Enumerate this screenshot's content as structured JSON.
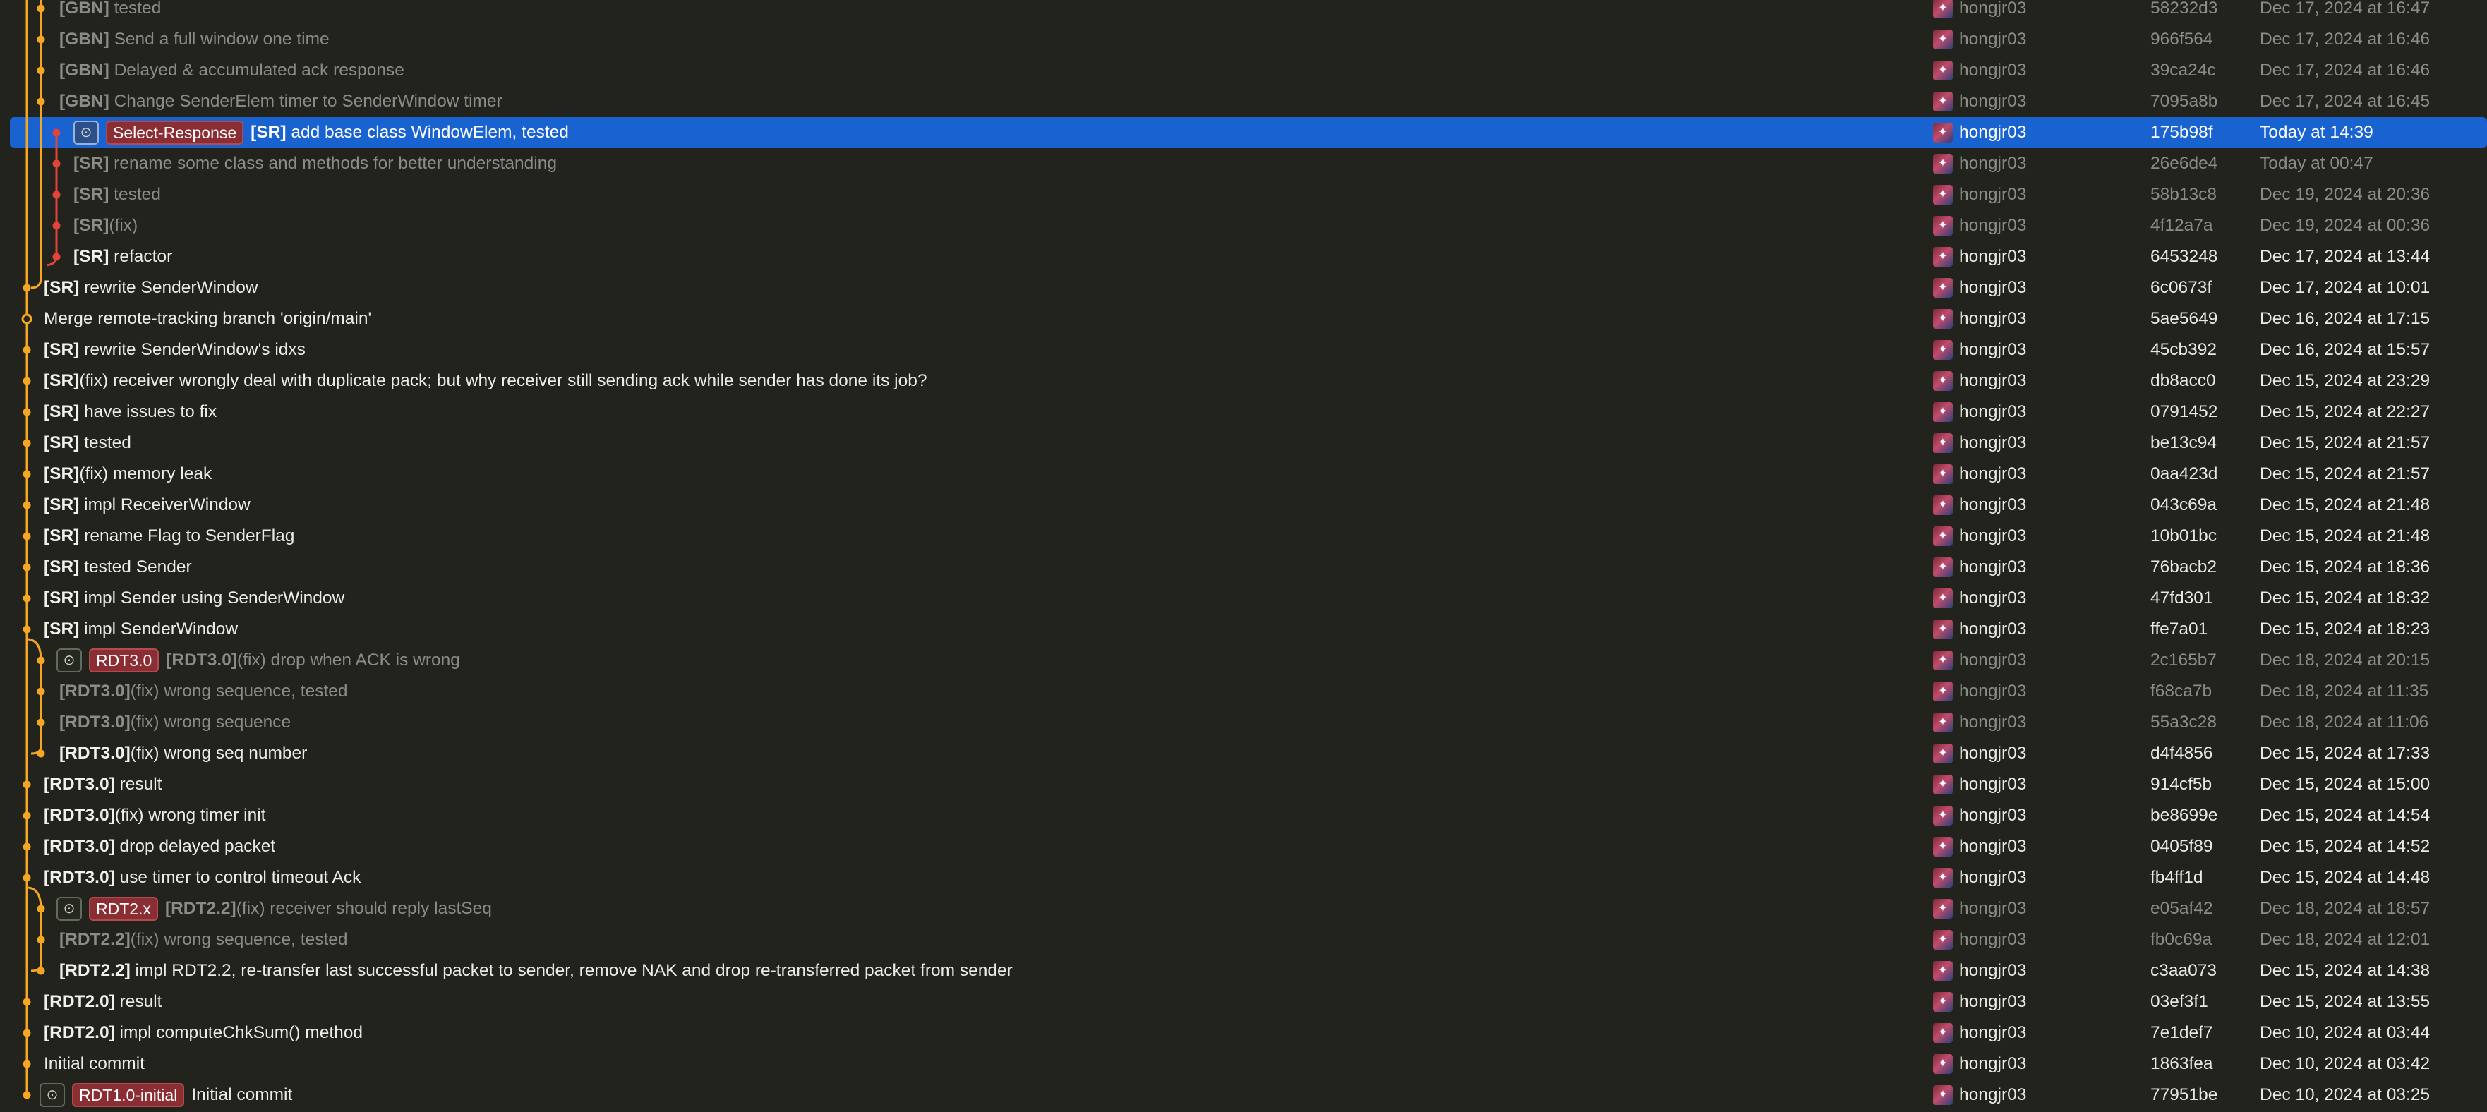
{
  "colors": {
    "background": "#22231c",
    "selection": "#1963d0",
    "graph_main": "#f5a623",
    "graph_branch": "#e2433a",
    "branch_label_bg": "#8a2e34"
  },
  "icons": {
    "remote": "github-icon"
  },
  "commits": [
    {
      "tag": "[GBN]",
      "message": "tested",
      "author": "hongjr03",
      "hash": "58232d3",
      "date": "Dec 17, 2024 at 16:47",
      "dim": true
    },
    {
      "tag": "[GBN]",
      "message": "Send a full window one time",
      "author": "hongjr03",
      "hash": "966f564",
      "date": "Dec 17, 2024 at 16:46",
      "dim": true
    },
    {
      "tag": "[GBN]",
      "message": "Delayed & accumulated ack response",
      "author": "hongjr03",
      "hash": "39ca24c",
      "date": "Dec 17, 2024 at 16:46",
      "dim": true
    },
    {
      "tag": "[GBN]",
      "message": "Change SenderElem timer to SenderWindow timer",
      "author": "hongjr03",
      "hash": "7095a8b",
      "date": "Dec 17, 2024 at 16:45",
      "dim": true
    },
    {
      "tag": "[SR]",
      "message": "add base class WindowElem, tested",
      "author": "hongjr03",
      "hash": "175b98f",
      "date": "Today at 14:39",
      "selected": true,
      "branch": "Select-Response",
      "remote": true
    },
    {
      "tag": "[SR]",
      "message": "rename some class and methods for better understanding",
      "author": "hongjr03",
      "hash": "26e6de4",
      "date": "Today at 00:47",
      "dim": true
    },
    {
      "tag": "[SR]",
      "message": "tested",
      "author": "hongjr03",
      "hash": "58b13c8",
      "date": "Dec 19, 2024 at 20:36",
      "dim": true
    },
    {
      "tag": "[SR]",
      "message": "(fix)",
      "author": "hongjr03",
      "hash": "4f12a7a",
      "date": "Dec 19, 2024 at 00:36",
      "dim": true
    },
    {
      "tag": "[SR]",
      "message": "refactor",
      "author": "hongjr03",
      "hash": "6453248",
      "date": "Dec 17, 2024 at 13:44"
    },
    {
      "tag": "[SR]",
      "message": "rewrite SenderWindow",
      "author": "hongjr03",
      "hash": "6c0673f",
      "date": "Dec 17, 2024 at 10:01"
    },
    {
      "tag": "",
      "message": "Merge remote-tracking branch 'origin/main'",
      "author": "hongjr03",
      "hash": "5ae5649",
      "date": "Dec 16, 2024 at 17:15"
    },
    {
      "tag": "[SR]",
      "message": "rewrite SenderWindow's idxs",
      "author": "hongjr03",
      "hash": "45cb392",
      "date": "Dec 16, 2024 at 15:57"
    },
    {
      "tag": "[SR]",
      "message": "(fix) receiver wrongly deal with duplicate pack; but why receiver still sending ack while sender has done its job?",
      "author": "hongjr03",
      "hash": "db8acc0",
      "date": "Dec 15, 2024 at 23:29"
    },
    {
      "tag": "[SR]",
      "message": "have issues to fix",
      "author": "hongjr03",
      "hash": "0791452",
      "date": "Dec 15, 2024 at 22:27"
    },
    {
      "tag": "[SR]",
      "message": "tested",
      "author": "hongjr03",
      "hash": "be13c94",
      "date": "Dec 15, 2024 at 21:57"
    },
    {
      "tag": "[SR]",
      "message": "(fix) memory leak",
      "author": "hongjr03",
      "hash": "0aa423d",
      "date": "Dec 15, 2024 at 21:57"
    },
    {
      "tag": "[SR]",
      "message": "impl ReceiverWindow",
      "author": "hongjr03",
      "hash": "043c69a",
      "date": "Dec 15, 2024 at 21:48"
    },
    {
      "tag": "[SR]",
      "message": "rename Flag to SenderFlag",
      "author": "hongjr03",
      "hash": "10b01bc",
      "date": "Dec 15, 2024 at 21:48"
    },
    {
      "tag": "[SR]",
      "message": "tested Sender",
      "author": "hongjr03",
      "hash": "76bacb2",
      "date": "Dec 15, 2024 at 18:36"
    },
    {
      "tag": "[SR]",
      "message": "impl Sender using SenderWindow",
      "author": "hongjr03",
      "hash": "47fd301",
      "date": "Dec 15, 2024 at 18:32"
    },
    {
      "tag": "[SR]",
      "message": "impl SenderWindow",
      "author": "hongjr03",
      "hash": "ffe7a01",
      "date": "Dec 15, 2024 at 18:23"
    },
    {
      "tag": "[RDT3.0]",
      "message": "(fix) drop when ACK is wrong",
      "author": "hongjr03",
      "hash": "2c165b7",
      "date": "Dec 18, 2024 at 20:15",
      "dim": true,
      "branch": "RDT3.0",
      "remote": true
    },
    {
      "tag": "[RDT3.0]",
      "message": "(fix) wrong sequence, tested",
      "author": "hongjr03",
      "hash": "f68ca7b",
      "date": "Dec 18, 2024 at 11:35",
      "dim": true
    },
    {
      "tag": "[RDT3.0]",
      "message": "(fix) wrong sequence",
      "author": "hongjr03",
      "hash": "55a3c28",
      "date": "Dec 18, 2024 at 11:06",
      "dim": true
    },
    {
      "tag": "[RDT3.0]",
      "message": "(fix) wrong seq number",
      "author": "hongjr03",
      "hash": "d4f4856",
      "date": "Dec 15, 2024 at 17:33"
    },
    {
      "tag": "[RDT3.0]",
      "message": "result",
      "author": "hongjr03",
      "hash": "914cf5b",
      "date": "Dec 15, 2024 at 15:00"
    },
    {
      "tag": "[RDT3.0]",
      "message": "(fix) wrong timer init",
      "author": "hongjr03",
      "hash": "be8699e",
      "date": "Dec 15, 2024 at 14:54"
    },
    {
      "tag": "[RDT3.0]",
      "message": "drop delayed packet",
      "author": "hongjr03",
      "hash": "0405f89",
      "date": "Dec 15, 2024 at 14:52"
    },
    {
      "tag": "[RDT3.0]",
      "message": "use timer to control timeout Ack",
      "author": "hongjr03",
      "hash": "fb4ff1d",
      "date": "Dec 15, 2024 at 14:48"
    },
    {
      "tag": "[RDT2.2]",
      "message": "(fix) receiver should reply lastSeq",
      "author": "hongjr03",
      "hash": "e05af42",
      "date": "Dec 18, 2024 at 18:57",
      "dim": true,
      "branch": "RDT2.x",
      "remote": true
    },
    {
      "tag": "[RDT2.2]",
      "message": "(fix) wrong sequence, tested",
      "author": "hongjr03",
      "hash": "fb0c69a",
      "date": "Dec 18, 2024 at 12:01",
      "dim": true
    },
    {
      "tag": "[RDT2.2]",
      "message": "impl RDT2.2, re-transfer last successful packet to sender, remove NAK and drop re-transferred packet from sender",
      "author": "hongjr03",
      "hash": "c3aa073",
      "date": "Dec 15, 2024 at 14:38"
    },
    {
      "tag": "[RDT2.0]",
      "message": "result",
      "author": "hongjr03",
      "hash": "03ef3f1",
      "date": "Dec 15, 2024 at 13:55"
    },
    {
      "tag": "[RDT2.0]",
      "message": "impl computeChkSum() method",
      "author": "hongjr03",
      "hash": "7e1def7",
      "date": "Dec 10, 2024 at 03:44"
    },
    {
      "tag": "",
      "message": "Initial commit",
      "author": "hongjr03",
      "hash": "1863fea",
      "date": "Dec 10, 2024 at 03:42"
    },
    {
      "tag": "",
      "message": "Initial commit",
      "author": "hongjr03",
      "hash": "77951be",
      "date": "Dec 10, 2024 at 03:25",
      "branch": "RDT1.0-initial",
      "remote": true
    }
  ]
}
